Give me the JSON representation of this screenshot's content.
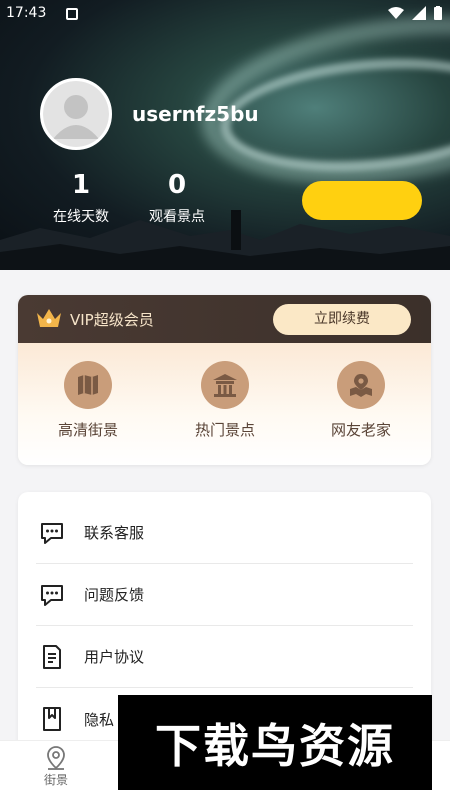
{
  "status_bar": {
    "time": "17:43"
  },
  "profile": {
    "username": "usernfz5bu",
    "stats": [
      {
        "value": "1",
        "label": "在线天数"
      },
      {
        "value": "0",
        "label": "观看景点"
      }
    ]
  },
  "vip": {
    "title": "VIP超级会员",
    "renew_label": "立即续费",
    "features": [
      {
        "label": "高清街景",
        "icon": "map-icon"
      },
      {
        "label": "热门景点",
        "icon": "temple-icon"
      },
      {
        "label": "网友老家",
        "icon": "location-map-icon"
      }
    ]
  },
  "menu": {
    "items": [
      {
        "label": "联系客服",
        "icon": "chat-icon"
      },
      {
        "label": "问题反馈",
        "icon": "feedback-icon"
      },
      {
        "label": "用户协议",
        "icon": "document-icon"
      },
      {
        "label": "隐私",
        "icon": "bookmark-doc-icon"
      }
    ]
  },
  "bottom_nav": {
    "items": [
      {
        "label": "街景",
        "icon": "location-pin-icon"
      }
    ]
  },
  "watermark": {
    "text": "下载鸟资源"
  },
  "colors": {
    "accent_yellow": "#ffd010",
    "vip_dark": "#3b302a",
    "vip_gold": "#c99d7a"
  }
}
